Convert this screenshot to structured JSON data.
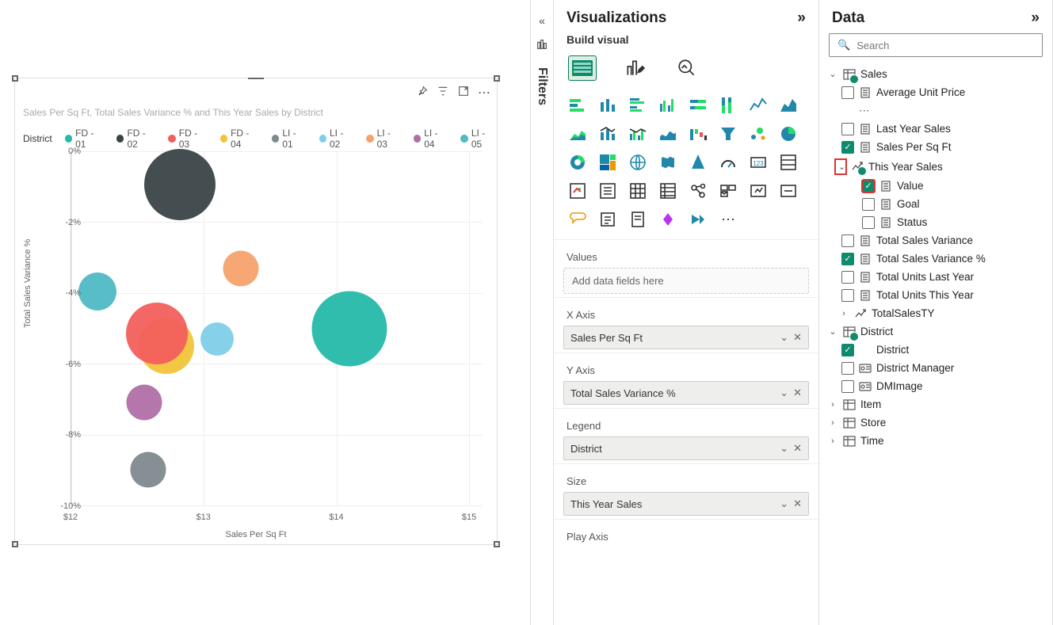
{
  "canvas": {
    "visual_title": "Sales Per Sq Ft, Total Sales Variance % and This Year Sales by District",
    "legend_label": "District",
    "legend_items": [
      {
        "name": "FD - 01",
        "color": "#26b9a9"
      },
      {
        "name": "FD - 02",
        "color": "#3a4346"
      },
      {
        "name": "FD - 03",
        "color": "#f25f5c"
      },
      {
        "name": "FD - 04",
        "color": "#f0c43a"
      },
      {
        "name": "LI - 01",
        "color": "#7f8a8e"
      },
      {
        "name": "LI - 02",
        "color": "#7fcfe8"
      },
      {
        "name": "LI - 03",
        "color": "#f6a26b"
      },
      {
        "name": "LI - 04",
        "color": "#b06fa6"
      },
      {
        "name": "LI - 05",
        "color": "#4fb9c4"
      }
    ],
    "x_axis_title": "Sales Per Sq Ft",
    "y_axis_title": "Total Sales Variance %",
    "x_ticks": [
      "$12",
      "$13",
      "$14",
      "$15"
    ],
    "y_ticks": [
      "0%",
      "-2%",
      "-4%",
      "-6%",
      "-8%",
      "-10%"
    ],
    "header_icons": [
      "pin",
      "filter",
      "focus",
      "more"
    ]
  },
  "chart_data": {
    "type": "scatter",
    "xlabel": "Sales Per Sq Ft",
    "ylabel": "Total Sales Variance %",
    "xlim": [
      12,
      15.1
    ],
    "ylim": [
      -10,
      0
    ],
    "size_field": "This Year Sales",
    "series": [
      {
        "name": "FD - 01",
        "color": "#26b9a9",
        "x": 14.1,
        "y": -5.0,
        "size": 95
      },
      {
        "name": "FD - 02",
        "color": "#3a4346",
        "x": 12.82,
        "y": -0.95,
        "size": 90
      },
      {
        "name": "FD - 03",
        "color": "#f25f5c",
        "x": 12.65,
        "y": -5.15,
        "size": 78
      },
      {
        "name": "FD - 04",
        "color": "#f0c43a",
        "x": 12.72,
        "y": -5.5,
        "size": 70
      },
      {
        "name": "LI - 01",
        "color": "#7f8a8e",
        "x": 12.58,
        "y": -9.0,
        "size": 45
      },
      {
        "name": "LI - 02",
        "color": "#7fcfe8",
        "x": 13.1,
        "y": -5.3,
        "size": 42
      },
      {
        "name": "LI - 03",
        "color": "#f6a26b",
        "x": 13.28,
        "y": -3.3,
        "size": 45
      },
      {
        "name": "LI - 04",
        "color": "#b06fa6",
        "x": 12.55,
        "y": -7.1,
        "size": 45
      },
      {
        "name": "LI - 05",
        "color": "#4fb9c4",
        "x": 12.2,
        "y": -3.95,
        "size": 48
      }
    ]
  },
  "filters_label": "Filters",
  "visualizations": {
    "title": "Visualizations",
    "subtitle": "Build visual",
    "wells": {
      "values_label": "Values",
      "values_placeholder": "Add data fields here",
      "xaxis_label": "X Axis",
      "xaxis_field": "Sales Per Sq Ft",
      "yaxis_label": "Y Axis",
      "yaxis_field": "Total Sales Variance %",
      "legend_label": "Legend",
      "legend_field": "District",
      "size_label": "Size",
      "size_field": "This Year Sales",
      "play_label": "Play Axis"
    }
  },
  "data_pane": {
    "title": "Data",
    "search_placeholder": "Search",
    "tree": {
      "sales": {
        "label": "Sales",
        "fields": {
          "avg_unit_price": "Average Unit Price",
          "last_year_sales": "Last Year Sales",
          "sales_per_sqft": "Sales Per Sq Ft",
          "this_year_sales": "This Year Sales",
          "value": "Value",
          "goal": "Goal",
          "status": "Status",
          "total_sales_variance": "Total Sales Variance",
          "total_sales_variance_pct": "Total Sales Variance %",
          "total_units_last_year": "Total Units Last Year",
          "total_units_this_year": "Total Units This Year",
          "total_sales_ty": "TotalSalesTY"
        }
      },
      "district": {
        "label": "District",
        "fields": {
          "district": "District",
          "district_manager": "District Manager",
          "dm_image": "DMImage"
        }
      },
      "item": "Item",
      "store": "Store",
      "time": "Time"
    }
  }
}
